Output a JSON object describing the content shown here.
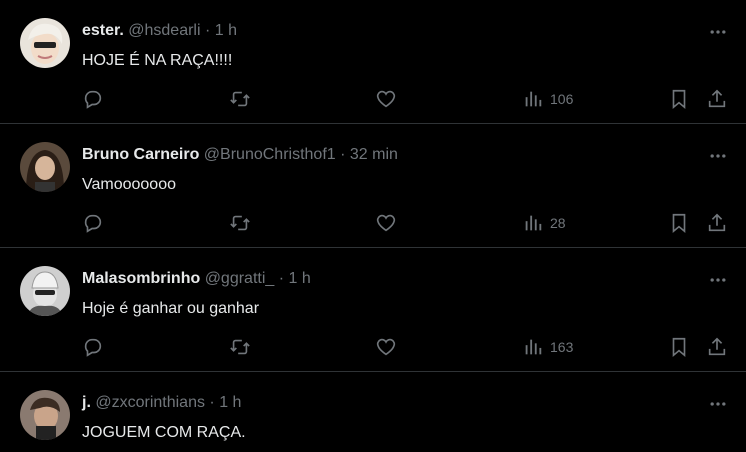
{
  "tweets": [
    {
      "name": "ester.",
      "handle": "@hsdearli",
      "sep": "·",
      "time": "1 h",
      "text": "HOJE É NA RAÇA!!!!",
      "views": "106"
    },
    {
      "name": "Bruno Carneiro",
      "handle": "@BrunoChristhof1",
      "sep": "·",
      "time": "32 min",
      "text": "Vamooooooo",
      "views": "28"
    },
    {
      "name": "Malasombrinho",
      "handle": "@ggratti_",
      "sep": "·",
      "time": "1 h",
      "text": "Hoje é ganhar ou ganhar",
      "views": "163"
    },
    {
      "name": "j.",
      "handle": "@zxcorinthians",
      "sep": "·",
      "time": "1 h",
      "text": "JOGUEM COM RAÇA."
    }
  ],
  "icons": {
    "more": "more-icon",
    "reply": "reply-icon",
    "retweet": "retweet-icon",
    "like": "like-icon",
    "views": "views-icon",
    "bookmark": "bookmark-icon",
    "share": "share-icon"
  },
  "colors": {
    "background": "#000000",
    "text": "#e7e9ea",
    "muted": "#71767b",
    "divider": "#2f3336"
  }
}
